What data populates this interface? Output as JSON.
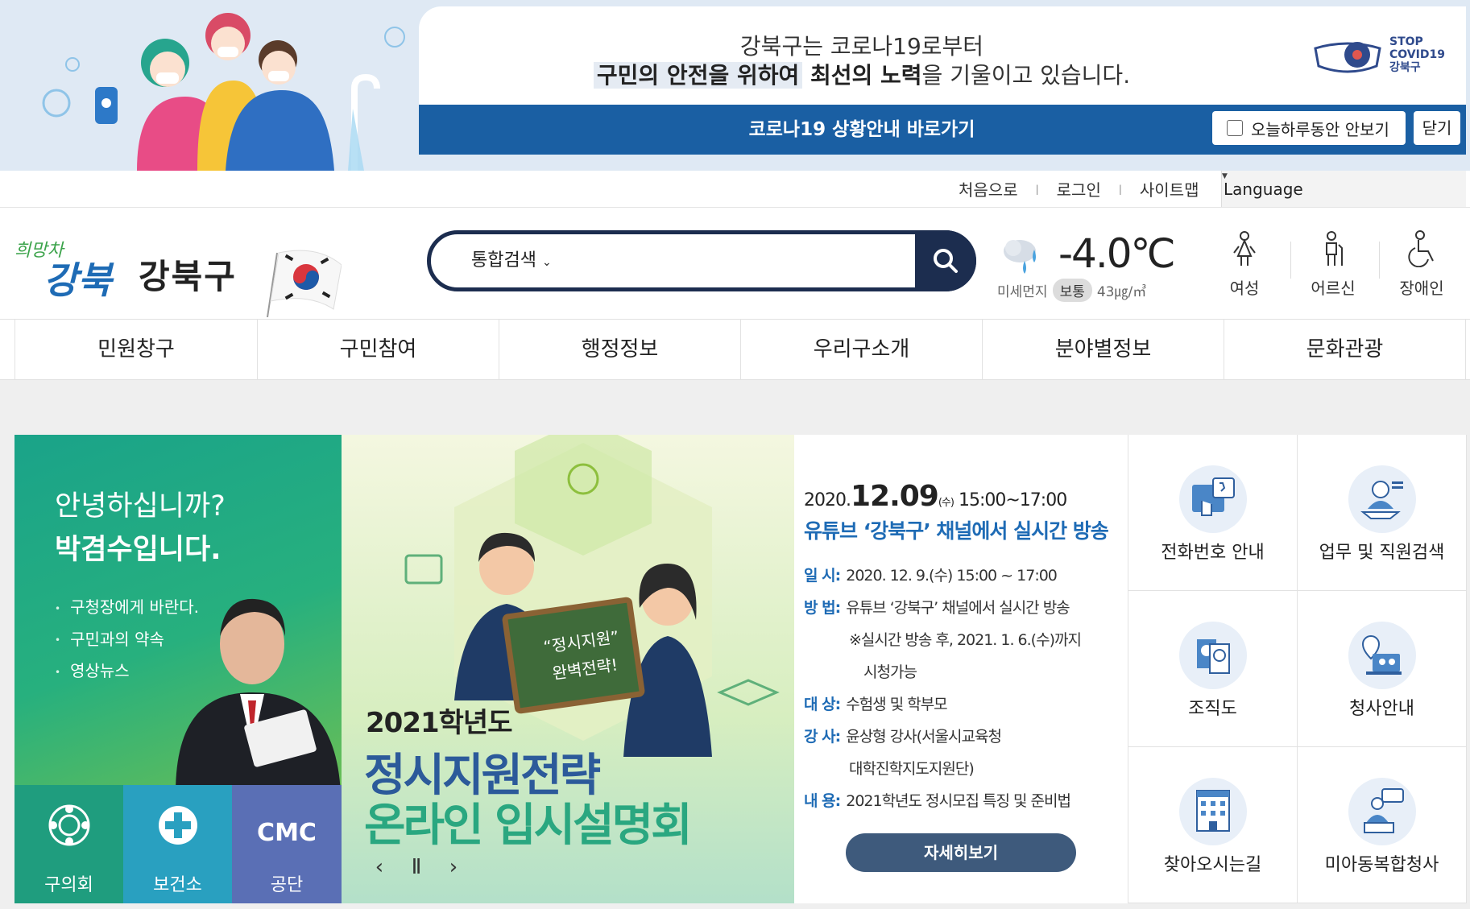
{
  "popup": {
    "line1": "강북구는 코로나19로부터",
    "line2_highlight": "구민의 안전을 위하여",
    "line2_bold": " 최선의 노력",
    "line2_rest": "을 기울이고 있습니다.",
    "stop_badge": [
      "STOP",
      "COVID19",
      "강북구"
    ],
    "bar_link": "코로나19 상황안내 바로가기",
    "not_today": "오늘하루동안 안보기",
    "close": "닫기"
  },
  "util": {
    "links": [
      "처음으로",
      "로그인",
      "사이트맵"
    ],
    "language": "Language"
  },
  "header": {
    "logo_slogan": "희망차 강북",
    "logo_text": "강북구",
    "search_category": "통합검색",
    "search_placeholder": "",
    "weather": {
      "temperature": "-4.0℃",
      "dust_label": "미세먼지",
      "dust_level": "보통",
      "dust_value": "43㎍/㎥"
    },
    "accessibility": [
      "여성",
      "어르신",
      "장애인"
    ]
  },
  "gnb": [
    "민원창구",
    "구민참여",
    "행정정보",
    "우리구소개",
    "분야별정보",
    "문화관광"
  ],
  "mayor": {
    "greeting": "안녕하십니까?",
    "name": "박겸수입니다.",
    "links": [
      "구청장에게 바란다.",
      "구민과의 약속",
      "영상뉴스"
    ],
    "quick": [
      {
        "label": "구의회",
        "color": "#1f9d7e",
        "icon": "council-emblem-icon"
      },
      {
        "label": "보건소",
        "color": "#29a0c0",
        "icon": "health-center-icon"
      },
      {
        "label": "공단",
        "color": "#5a6fb5",
        "icon": "cmc-logo-icon",
        "mark": "CMC"
      }
    ]
  },
  "banner": {
    "board_text": [
      "“정시지원”",
      "완벽전략!"
    ],
    "year": "2021학년도",
    "title1": "정시지원전략",
    "title2": "온라인 입시설명회",
    "controls": [
      "‹",
      "Ⅱ",
      "›"
    ]
  },
  "event": {
    "date_prefix": "2020.",
    "date_big": "12.09",
    "date_day": "(수)",
    "date_time": " 15:00~17:00",
    "title": "유튜브 ‘강북구’ 채널에서 실시간 방송",
    "rows": [
      {
        "key": "일 시:",
        "value": " 2020. 12. 9.(수) 15:00 ~ 17:00"
      },
      {
        "key": "방 법:",
        "value": " 유튜브 ‘강북구’ 채널에서 실시간 방송"
      },
      {
        "key": "대 상:",
        "value": " 수험생 및 학부모"
      },
      {
        "key": "강 사:",
        "value": " 윤상형 강사(서울시교육청"
      },
      {
        "key": "내 용:",
        "value": " 2021학년도 정시모집 특징 및 준비법"
      }
    ],
    "method_sub1": "※실시간 방송 후, 2021. 1. 6.(수)까지",
    "method_sub2": "시청가능",
    "lecturer_sub": "대학진학지도지원단)",
    "more": "자세히보기"
  },
  "tiles": [
    {
      "label": "전화번호 안내",
      "icon": "phone-directory-icon"
    },
    {
      "label": "업무 및 직원검색",
      "icon": "staff-search-icon"
    },
    {
      "label": "조직도",
      "icon": "organization-chart-icon"
    },
    {
      "label": "청사안내",
      "icon": "office-guide-icon"
    },
    {
      "label": "찾아오시는길",
      "icon": "directions-building-icon"
    },
    {
      "label": "미아동복합청사",
      "icon": "complex-office-icon"
    }
  ],
  "colors": {
    "navy": "#1c2d4f",
    "popup_bar": "#1a5fa3",
    "mayor_green": "#1aa389",
    "event_blue": "#1e6bb5"
  }
}
